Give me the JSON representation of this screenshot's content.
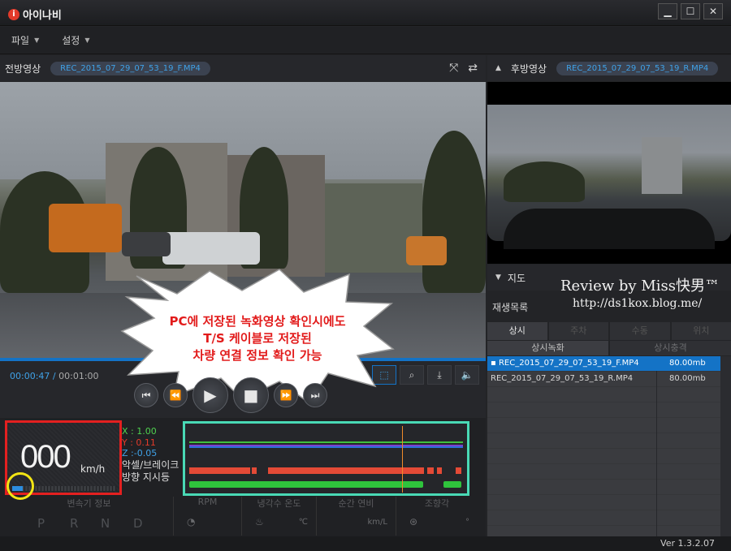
{
  "app": {
    "title": "아이나비",
    "logo_mark": "i"
  },
  "window_buttons": {
    "minimize": "▁",
    "maximize": "☐",
    "close": "✕"
  },
  "menu": [
    {
      "label": "파일"
    },
    {
      "label": "설정"
    }
  ],
  "front": {
    "label": "전방영상",
    "file": "REC_2015_07_29_07_53_19_F.MP4",
    "progress": 0.78
  },
  "rear": {
    "label": "후방영상",
    "file": "REC_2015_07_29_07_53_19_R.MP4"
  },
  "playback": {
    "current": "00:00:47",
    "separator": "/",
    "total": "00:01:00"
  },
  "overlay": {
    "lines": [
      "PC에 저장된 녹화영상 확인시에도",
      "T/S 케이블로 저장된",
      "차량 연결 정보 확인 가능"
    ]
  },
  "dashboard": {
    "speed": "000",
    "speed_unit": "km/h",
    "speed_level": 0.1,
    "sensor": {
      "x": "X : 1.00",
      "y": "Y : 0.11",
      "z": "Z :-0.05"
    },
    "labels": {
      "brake": "악셀/브레이크",
      "turn": "방향 지시등"
    },
    "info": {
      "gear_title": "변속기 정보",
      "gears": [
        "P",
        "R",
        "N",
        "D"
      ],
      "rpm_title": "RPM",
      "coolant_title": "냉각수 온도",
      "coolant_unit": "℃",
      "fuel_title": "순간 연비",
      "fuel_unit": "km/L",
      "steer_title": "조향각",
      "steer_unit": "°"
    }
  },
  "map": {
    "label": "지도"
  },
  "watermark": {
    "review": "Review by Miss快男™",
    "url": "http://ds1kox.blog.me/"
  },
  "list": {
    "title": "재생목록",
    "tabs": [
      "상시",
      "주차",
      "수동",
      "위치"
    ],
    "subtabs": [
      "상시녹화",
      "상시충격"
    ],
    "files": [
      {
        "name": "REC_2015_07_29_07_53_19_F.MP4",
        "size": "80.00mb",
        "selected": true
      },
      {
        "name": "REC_2015_07_29_07_53_19_R.MP4",
        "size": "80.00mb",
        "selected": false
      }
    ]
  },
  "version": "Ver 1.3.2.07"
}
